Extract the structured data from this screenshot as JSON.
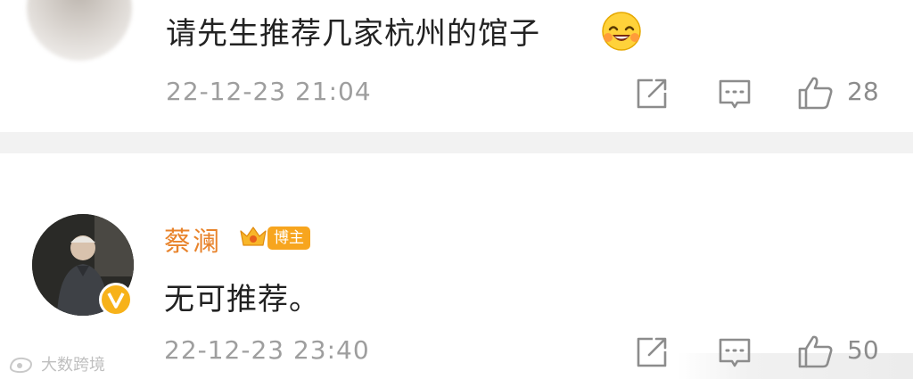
{
  "comments": [
    {
      "text": "请先生推荐几家杭州的馆子",
      "emoji": "grinning-face-emoji",
      "timestamp": "22-12-23 21:04",
      "likes": "28"
    },
    {
      "username": "蔡澜",
      "badge": "博主",
      "text": "无可推荐。",
      "timestamp": "22-12-23 23:40",
      "likes": "50"
    }
  ],
  "icons": {
    "share": "share-icon",
    "comment": "comment-icon",
    "like": "thumbs-up-icon",
    "verified": "verified-v-icon",
    "crown": "crown-icon"
  },
  "watermark": "大数跨境",
  "colors": {
    "username": "#e8832b",
    "badge": "#f7a51e",
    "divider": "#f2f2f2",
    "meta": "#9e9e9e"
  }
}
